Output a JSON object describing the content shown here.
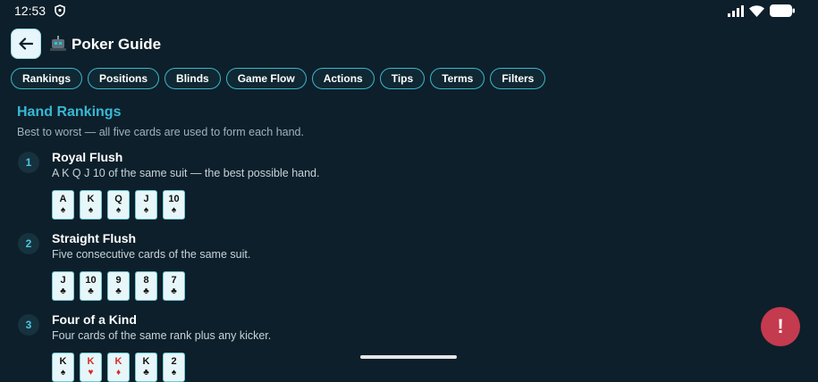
{
  "status_bar": {
    "time": "12:53"
  },
  "header": {
    "title": "Poker Guide"
  },
  "tabs": [
    {
      "label": "Rankings"
    },
    {
      "label": "Positions"
    },
    {
      "label": "Blinds"
    },
    {
      "label": "Game Flow"
    },
    {
      "label": "Actions"
    },
    {
      "label": "Tips"
    },
    {
      "label": "Terms"
    },
    {
      "label": "Filters"
    }
  ],
  "section": {
    "title": "Hand Rankings",
    "subtitle": "Best to worst — all five cards are used to form each hand."
  },
  "hands": [
    {
      "rank": "1",
      "name": "Royal Flush",
      "description": "A K Q J 10 of the same suit — the best possible hand.",
      "cards": [
        {
          "rank": "A",
          "suit": "♠",
          "color": "black"
        },
        {
          "rank": "K",
          "suit": "♠",
          "color": "black"
        },
        {
          "rank": "Q",
          "suit": "♠",
          "color": "black"
        },
        {
          "rank": "J",
          "suit": "♠",
          "color": "black"
        },
        {
          "rank": "10",
          "suit": "♠",
          "color": "black"
        }
      ]
    },
    {
      "rank": "2",
      "name": "Straight Flush",
      "description": "Five consecutive cards of the same suit.",
      "cards": [
        {
          "rank": "J",
          "suit": "♣",
          "color": "black"
        },
        {
          "rank": "10",
          "suit": "♣",
          "color": "black"
        },
        {
          "rank": "9",
          "suit": "♣",
          "color": "black"
        },
        {
          "rank": "8",
          "suit": "♣",
          "color": "black"
        },
        {
          "rank": "7",
          "suit": "♣",
          "color": "black"
        }
      ]
    },
    {
      "rank": "3",
      "name": "Four of a Kind",
      "description": "Four cards of the same rank plus any kicker.",
      "cards": [
        {
          "rank": "K",
          "suit": "♠",
          "color": "black"
        },
        {
          "rank": "K",
          "suit": "♥",
          "color": "red"
        },
        {
          "rank": "K",
          "suit": "♦",
          "color": "red"
        },
        {
          "rank": "K",
          "suit": "♣",
          "color": "black"
        },
        {
          "rank": "2",
          "suit": "♠",
          "color": "black"
        }
      ]
    }
  ],
  "fab": {
    "label": "!"
  },
  "colors": {
    "accent": "#37b9d4",
    "background": "#0d1f2a",
    "fab": "#c43a4e",
    "card_red": "#d42c2c"
  },
  "icons": {
    "back": "arrow-left-icon",
    "logo": "robot-icon",
    "status_shield": "shield-icon",
    "signal": "signal-icon",
    "wifi": "wifi-icon",
    "battery": "battery-icon"
  }
}
